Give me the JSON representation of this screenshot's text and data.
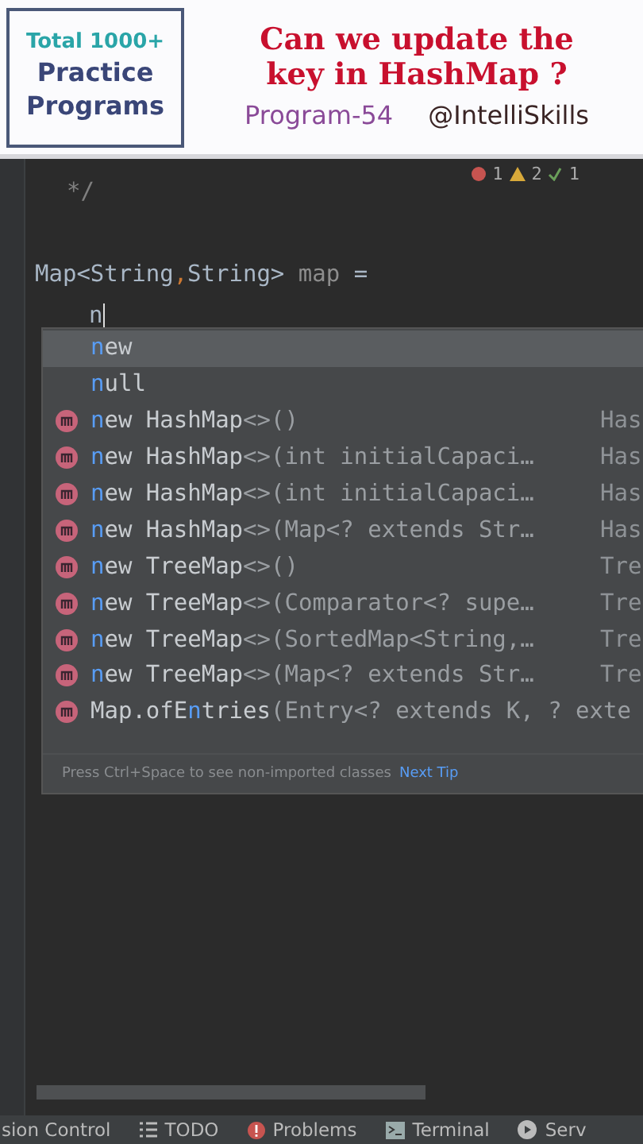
{
  "banner": {
    "badge_lines": [
      "Total 1000+",
      "Practice",
      "Programs"
    ],
    "title_lines": [
      "Can we update the",
      "key in HashMap ?"
    ],
    "program": "Program-54",
    "handle": "@IntelliSkills"
  },
  "inspections": [
    {
      "kind": "error",
      "count": "1"
    },
    {
      "kind": "warning",
      "count": "2"
    },
    {
      "kind": "ok",
      "count": "1"
    }
  ],
  "code_lines": [
    {
      "kind": "comment",
      "text": "*/"
    },
    {
      "kind": "blank"
    },
    {
      "kind": "declaration",
      "type": "Map<String",
      "comma": ",",
      "type2": "String>",
      "name": "map",
      "op": "="
    },
    {
      "kind": "typing",
      "text": "n"
    }
  ],
  "completion": {
    "items": [
      {
        "kind": "keyword",
        "match": "n",
        "after": "ew",
        "selected": true
      },
      {
        "kind": "keyword",
        "match": "n",
        "after": "ull",
        "selected": false
      },
      {
        "kind": "method",
        "match": "n",
        "after": "ew HashMap",
        "params": "<>()",
        "type": "Has",
        "selected": false
      },
      {
        "kind": "method",
        "match": "n",
        "after": "ew HashMap",
        "params": "<>(int initialCapaci…",
        "type": "Has",
        "selected": false
      },
      {
        "kind": "method",
        "match": "n",
        "after": "ew HashMap",
        "params": "<>(int initialCapaci…",
        "type": "Has",
        "selected": false
      },
      {
        "kind": "method",
        "match": "n",
        "after": "ew HashMap",
        "params": "<>(Map<? extends Str…",
        "type": "Has",
        "selected": false
      },
      {
        "kind": "method",
        "match": "n",
        "after": "ew TreeMap",
        "params": "<>()",
        "type": "Tre",
        "selected": false
      },
      {
        "kind": "method",
        "match": "n",
        "after": "ew TreeMap",
        "params": "<>(Comparator<? supe…",
        "type": "Tre",
        "selected": false
      },
      {
        "kind": "method",
        "match": "n",
        "after": "ew TreeMap",
        "params": "<>(SortedMap<String,…",
        "type": "Tre",
        "selected": false
      },
      {
        "kind": "method",
        "match": "n",
        "after": "ew TreeMap",
        "params": "<>(Map<? extends Str…",
        "type": "Tre",
        "selected": false
      },
      {
        "kind": "method",
        "before": "Map.ofE",
        "match": "n",
        "after": "tries",
        "params": "(Entry<? extends K, ? exte",
        "selected": false
      }
    ],
    "tip": "Press Ctrl+Space to see non-imported classes",
    "tip_link": "Next Tip"
  },
  "status_bar": [
    {
      "kind": "text",
      "label": "sion Control"
    },
    {
      "kind": "list",
      "label": "TODO"
    },
    {
      "kind": "problems",
      "label": "Problems"
    },
    {
      "kind": "terminal",
      "label": "Terminal"
    },
    {
      "kind": "services",
      "label": "Serv"
    }
  ]
}
